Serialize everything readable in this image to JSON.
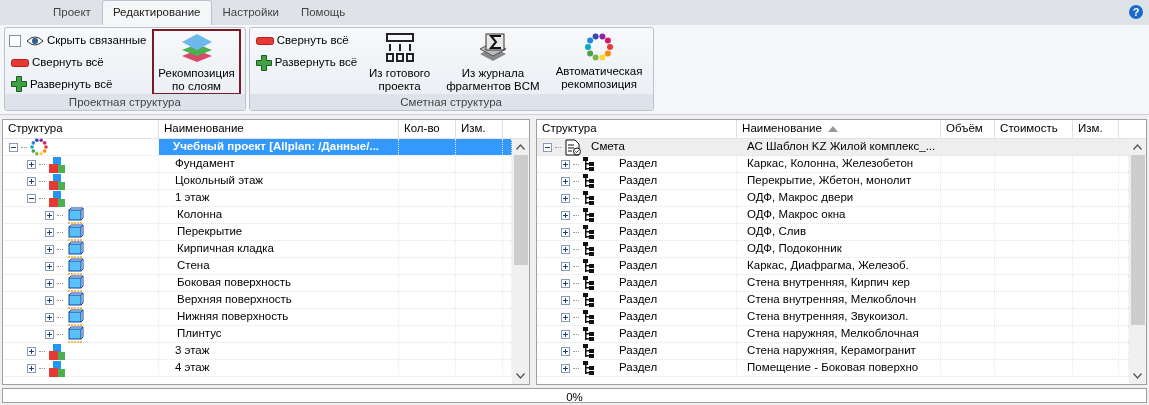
{
  "tabs": [
    {
      "label": "Проект",
      "selected": false
    },
    {
      "label": "Редактирование",
      "selected": true
    },
    {
      "label": "Настройки",
      "selected": false
    },
    {
      "label": "Помощь",
      "selected": false
    }
  ],
  "help": "?",
  "ribbon_groups": [
    {
      "label": "Проектная структура",
      "small": [
        {
          "kind": "checkbox",
          "label": "Скрыть связанные",
          "checked": false
        },
        {
          "kind": "collapse",
          "label": "Свернуть всё"
        },
        {
          "kind": "expand",
          "label": "Развернуть всё"
        }
      ],
      "large": [
        {
          "kind": "layers",
          "label": "Рекомпозиция\nпо слоям",
          "selected": true
        }
      ]
    },
    {
      "label": "Сметная структура",
      "small": [
        {
          "kind": "collapse",
          "label": "Свернуть всё"
        },
        {
          "kind": "expand",
          "label": "Развернуть всё"
        }
      ],
      "large": [
        {
          "kind": "ready",
          "label": "Из готового\nпроекта",
          "selected": false
        },
        {
          "kind": "journal",
          "label": "Из журнала\nфрагментов BCM",
          "selected": false
        },
        {
          "kind": "auto",
          "label": "Автоматическая\nрекомпозиция",
          "selected": false
        }
      ]
    }
  ],
  "project_tree": {
    "focused": true,
    "columns": [
      {
        "label": "Структура"
      },
      {
        "label": "Наименование"
      },
      {
        "label": "Кол-во"
      },
      {
        "label": "Изм."
      }
    ],
    "nodes": [
      {
        "kind": "project",
        "name": "Учебный проект [Allplan: /Данные/...",
        "expanded": true,
        "selected": true,
        "children": [
          {
            "kind": "floor",
            "name": "Фундамент",
            "expanded": false,
            "selected": false
          },
          {
            "kind": "floor",
            "name": "Цокольный этаж",
            "expanded": false,
            "selected": false
          },
          {
            "kind": "floor",
            "name": "1 этаж",
            "expanded": true,
            "selected": false,
            "children": [
              {
                "kind": "layer",
                "name": "Колонна",
                "expanded": false,
                "selected": false
              },
              {
                "kind": "layer",
                "name": "Перекрытие",
                "expanded": false,
                "selected": false
              },
              {
                "kind": "layer",
                "name": "Кирпичная кладка",
                "expanded": false,
                "selected": false
              },
              {
                "kind": "layer",
                "name": "Стена",
                "expanded": false,
                "selected": false
              },
              {
                "kind": "layer",
                "name": "Боковая поверхность",
                "expanded": false,
                "selected": false
              },
              {
                "kind": "layer",
                "name": "Верхняя поверхность",
                "expanded": false,
                "selected": false
              },
              {
                "kind": "layer",
                "name": "Нижняя поверхность",
                "expanded": false,
                "selected": false
              },
              {
                "kind": "layer",
                "name": "Плинтус",
                "expanded": false,
                "selected": false
              }
            ]
          },
          {
            "kind": "floor",
            "name": "3 этаж",
            "expanded": false,
            "selected": false
          },
          {
            "kind": "floor",
            "name": "4 этаж",
            "expanded": false,
            "selected": false
          }
        ]
      }
    ]
  },
  "estimate_tree": {
    "focused": false,
    "columns": [
      {
        "label": "Структура"
      },
      {
        "label": "Наименование",
        "sorted": true
      },
      {
        "label": "Объём"
      },
      {
        "label": "Стоимость"
      },
      {
        "label": "Изм."
      }
    ],
    "nodes": [
      {
        "kind": "estimate",
        "type": "Смета",
        "name": "АС Шаблон KZ Жилой комплекс_...",
        "expanded": true,
        "selected": true,
        "children": [
          {
            "kind": "section",
            "type": "Раздел",
            "name": "Каркас, Колонна, Железобетон",
            "expanded": false,
            "selected": false
          },
          {
            "kind": "section",
            "type": "Раздел",
            "name": "Перекрытие, Жбетон, монолит",
            "expanded": false,
            "selected": false
          },
          {
            "kind": "section",
            "type": "Раздел",
            "name": "ОДФ, Макрос двери",
            "expanded": false,
            "selected": false
          },
          {
            "kind": "section",
            "type": "Раздел",
            "name": "ОДФ, Макрос окна",
            "expanded": false,
            "selected": false
          },
          {
            "kind": "section",
            "type": "Раздел",
            "name": "ОДФ, Слив",
            "expanded": false,
            "selected": false
          },
          {
            "kind": "section",
            "type": "Раздел",
            "name": "ОДФ, Подоконник",
            "expanded": false,
            "selected": false
          },
          {
            "kind": "section",
            "type": "Раздел",
            "name": "Каркас, Диафрагма, Железоб.",
            "expanded": false,
            "selected": false
          },
          {
            "kind": "section",
            "type": "Раздел",
            "name": "Стена внутренняя, Кирпич кер",
            "expanded": false,
            "selected": false
          },
          {
            "kind": "section",
            "type": "Раздел",
            "name": "Стена внутренняя, Мелкоблочн",
            "expanded": false,
            "selected": false
          },
          {
            "kind": "section",
            "type": "Раздел",
            "name": "Стена внутренняя, Звукоизол.",
            "expanded": false,
            "selected": false
          },
          {
            "kind": "section",
            "type": "Раздел",
            "name": "Стена наружняя, Мелкоблочная",
            "expanded": false,
            "selected": false
          },
          {
            "kind": "section",
            "type": "Раздел",
            "name": "Стена наружняя, Керамогранит",
            "expanded": false,
            "selected": false
          },
          {
            "kind": "section",
            "type": "Раздел",
            "name": "Помещение - Боковая поверхно",
            "expanded": false,
            "selected": false
          }
        ]
      }
    ]
  },
  "progress": {
    "text": "0%",
    "level": 0
  }
}
